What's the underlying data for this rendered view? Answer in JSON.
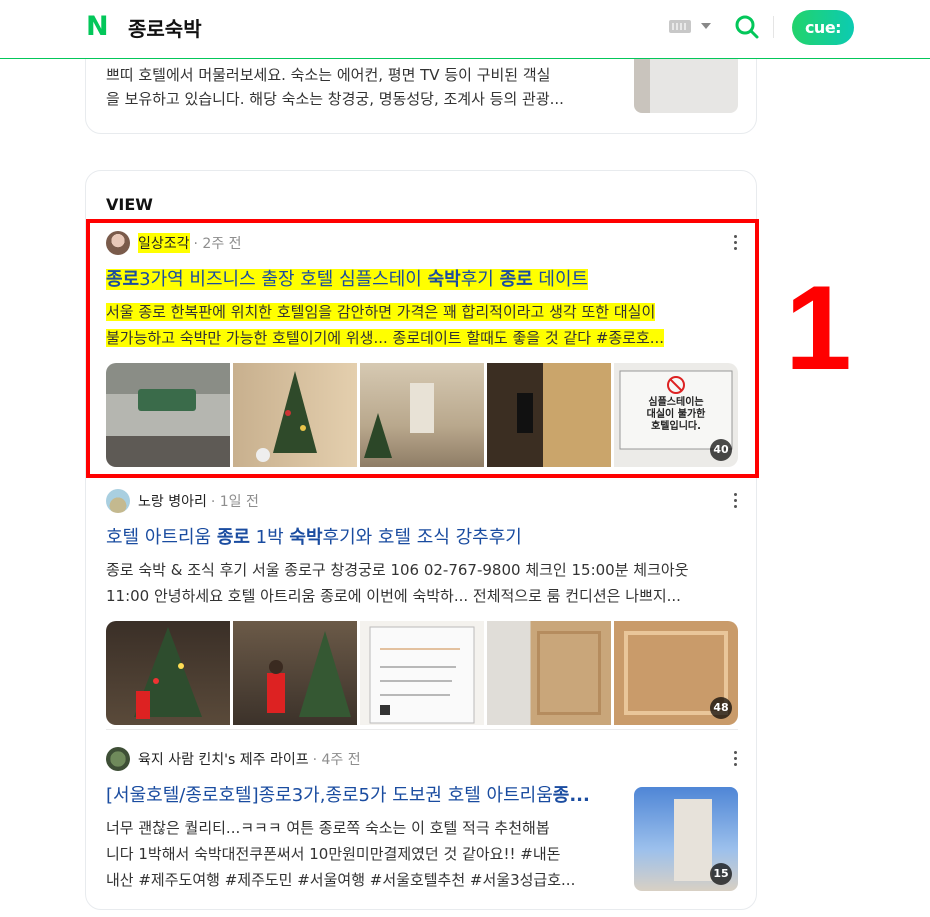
{
  "header": {
    "logo": "N",
    "query": "종로숙박",
    "cue_label": "cue:"
  },
  "top_snippet": {
    "lines": [
      "쁘띠 호텔에서 머물러보세요. 숙소는 에어컨, 평면 TV 등이 구비된 객실",
      "을 보유하고 있습니다. 해당 숙소는 창경궁, 명동성당, 조계사 등의 관광..."
    ]
  },
  "view_section": {
    "title": "VIEW",
    "annotation_number": "1",
    "posts": [
      {
        "author": "일상조각",
        "time": "· 2주 전",
        "title_parts": [
          {
            "text": "종로",
            "bold": true
          },
          {
            "text": "3가역 비즈니스 출장 호텔 심플스테이 ",
            "bold": false
          },
          {
            "text": "숙박",
            "bold": true
          },
          {
            "text": "후기 ",
            "bold": false
          },
          {
            "text": "종로",
            "bold": true
          },
          {
            "text": " 데이트",
            "bold": false
          }
        ],
        "desc": [
          "서울 종로 한복판에 위치한 호텔임을 감안하면 가격은 꽤 합리적이라고 생각 또한 대실이",
          "불가능하고 숙박만 가능한 호텔이기에 위생... 종로데이트 할때도 좋을 것 같다 #종로호..."
        ],
        "image_count": "40",
        "sign_text": [
          "심플스테이는",
          "대실이 불가한",
          "호텔입니다."
        ]
      },
      {
        "author": "노랑 병아리",
        "time": "· 1일 전",
        "title_parts": [
          {
            "text": "호텔 아트리움 ",
            "bold": false
          },
          {
            "text": "종로",
            "bold": true
          },
          {
            "text": " 1박 ",
            "bold": false
          },
          {
            "text": "숙박",
            "bold": true
          },
          {
            "text": "후기와 호텔 조식 강추후기",
            "bold": false
          }
        ],
        "desc": [
          "종로 숙박 & 조식 후기 서울 종로구 창경궁로 106 02-767-9800 체크인 15:00분 체크아웃",
          "11:00 안녕하세요 호텔 아트리움 종로에 이번에 숙박하... 전체적으로 룸 컨디션은 나쁘지..."
        ],
        "image_count": "48"
      },
      {
        "author": "육지 사람 킨치's 제주 라이프",
        "time": "· 4주 전",
        "title_parts": [
          {
            "text": "[서울호텔/종로호텔]종로3가,종로5가 도보권 호텔 아트리움",
            "bold": false
          },
          {
            "text": "종...",
            "bold": true
          }
        ],
        "desc": [
          "너무 괜찮은 퀄리티...ㅋㅋㅋ 여튼 종로쪽 숙소는 이 호텔 적극 추천해봅",
          "니다 1박해서 숙박대전쿠폰써서 10만원미만결제였던 것 같아요!! #내돈",
          "내산 #제주도여행 #제주도민 #서울여행 #서울호텔추천 #서울3성급호..."
        ],
        "image_count": "15"
      }
    ]
  }
}
